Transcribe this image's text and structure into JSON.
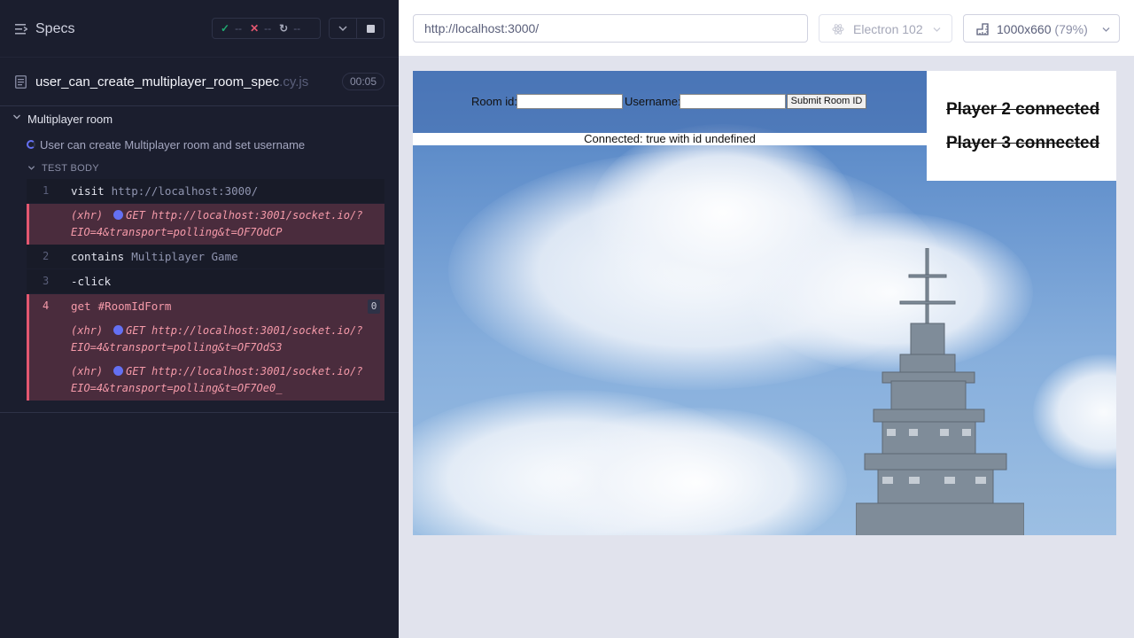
{
  "reporter": {
    "header": {
      "title": "Specs",
      "passed": "--",
      "failed": "--",
      "pending": "--"
    },
    "spec": {
      "name": "user_can_create_multiplayer_room_spec",
      "ext": ".cy.js",
      "duration": "00:05"
    },
    "suite": {
      "title": "Multiplayer room"
    },
    "test": {
      "title": "User can create Multiplayer room and set username",
      "body_label": "TEST BODY"
    },
    "commands": [
      {
        "num": "1",
        "name": "visit",
        "message": "http://localhost:3000/"
      },
      {
        "xhr": "(xhr)",
        "method": "GET",
        "line1": "http://localhost:3001/socket.io/?",
        "line2": "EIO=4&transport=polling&t=OF7OdCP"
      },
      {
        "num": "2",
        "name": "contains",
        "message": "Multiplayer Game"
      },
      {
        "num": "3",
        "name": "-click",
        "message": ""
      },
      {
        "num": "4",
        "name": "get",
        "message": "#RoomIdForm",
        "badge": "0"
      },
      {
        "xhr": "(xhr)",
        "method": "GET",
        "line1": "http://localhost:3001/socket.io/?",
        "line2": "EIO=4&transport=polling&t=OF7OdS3"
      },
      {
        "xhr": "(xhr)",
        "method": "GET",
        "line1": "http://localhost:3001/socket.io/?",
        "line2": "EIO=4&transport=polling&t=OF7Oe0_"
      }
    ]
  },
  "topbar": {
    "url": "http://localhost:3000/",
    "browser": "Electron 102",
    "viewport": "1000x660",
    "zoom": "(79%)"
  },
  "app": {
    "room_id_label": "Room id:",
    "username_label": "Username:",
    "submit_label": "Submit Room ID",
    "status": "Connected: true with id undefined",
    "players": [
      "Player 2 connected",
      "Player 3 connected"
    ]
  },
  "colors": {
    "reporter_bg": "#1b1e2e",
    "fail": "#e45770",
    "pass": "#1fa971",
    "accent": "#6470f3"
  }
}
